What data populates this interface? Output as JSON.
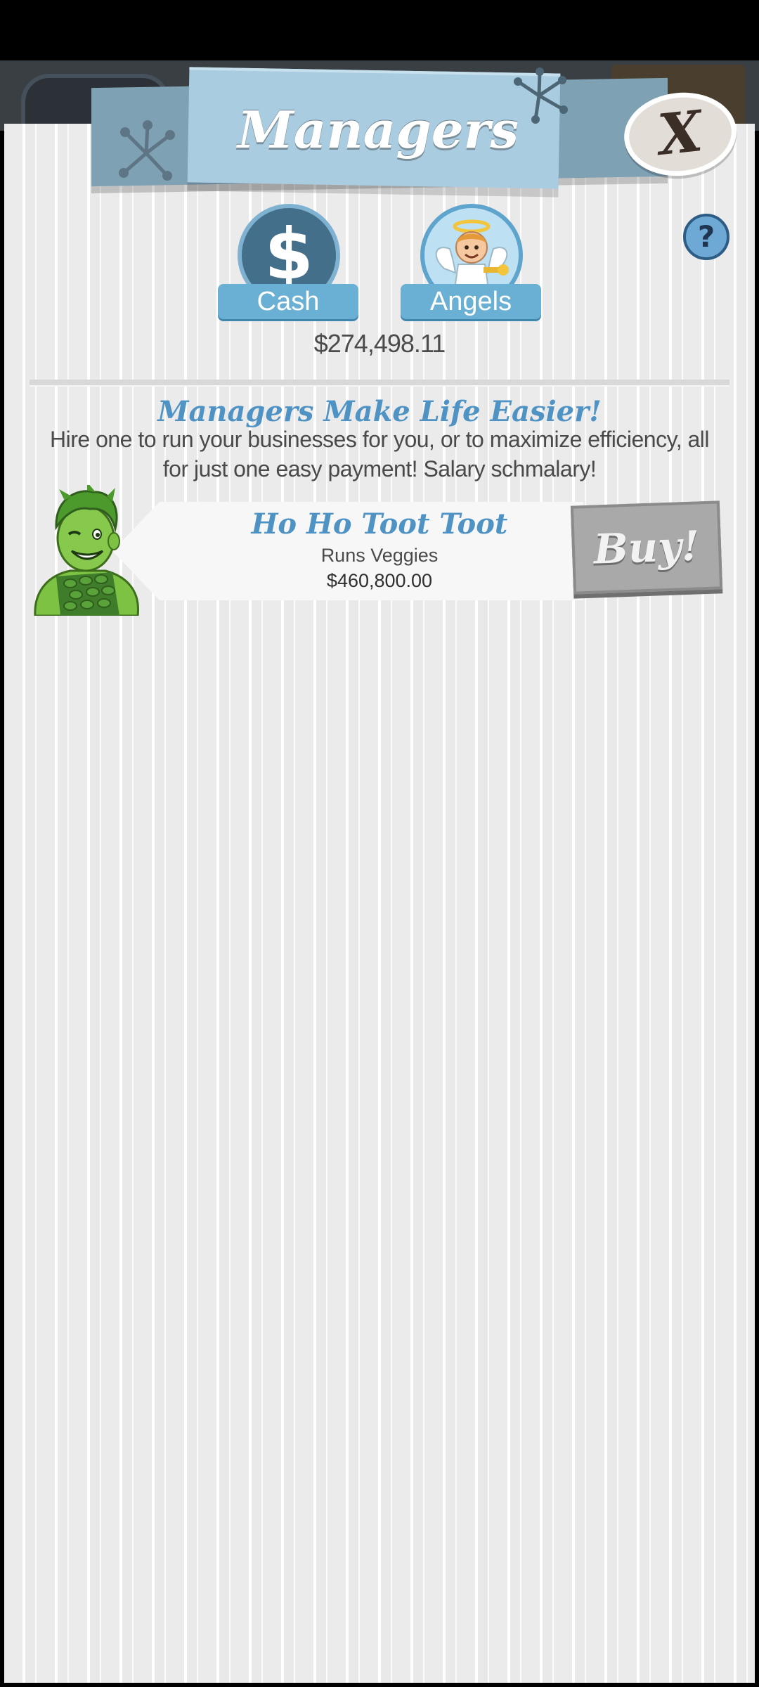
{
  "header": {
    "title": "Managers",
    "close_label": "X",
    "help_label": "?"
  },
  "currency_tabs": [
    {
      "label": "Cash",
      "icon": "dollar-icon"
    },
    {
      "label": "Angels",
      "icon": "angel-icon"
    }
  ],
  "balance": "$274,498.11",
  "intro": {
    "title": "Managers Make Life Easier!",
    "description": "Hire one to run your businesses for you, or to maximize efficiency, all for just one easy payment! Salary schmalary!"
  },
  "managers": [
    {
      "name": "Ho Ho Toot Toot",
      "runs": "Runs Veggies",
      "cost": "$460,800.00",
      "buy_label": "Buy!",
      "portrait": "green-giant-portrait"
    }
  ],
  "colors": {
    "accent_blue": "#4e93c4",
    "banner_blue": "#a9cce1",
    "buy_disabled": "#a9a9a9",
    "panel_bg": "#ececec"
  }
}
